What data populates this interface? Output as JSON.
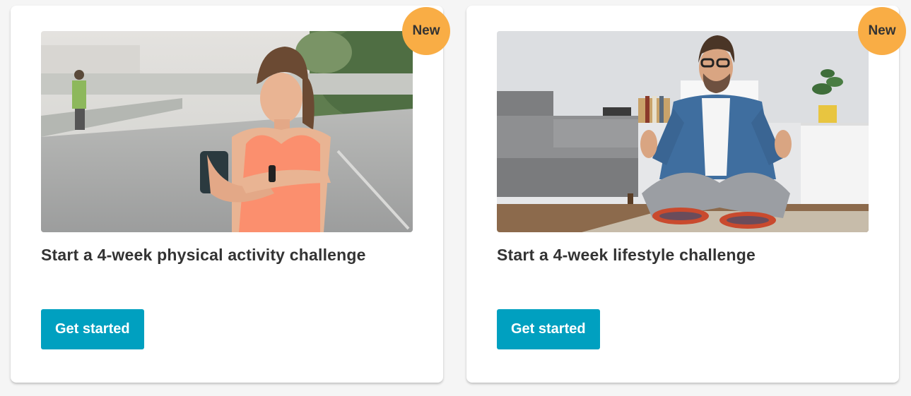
{
  "cards": [
    {
      "badge": "New",
      "title": "Start a 4-week physical activity challenge",
      "button_label": "Get started",
      "image": "woman-runner-checking-fitness-tracker"
    },
    {
      "badge": "New",
      "title": "Start a 4-week lifestyle challenge",
      "button_label": "Get started",
      "image": "man-meditating-in-living-room"
    }
  ],
  "colors": {
    "badge": "#f9ad45",
    "button": "#00a0c0",
    "title_text": "#333333",
    "page_bg": "#f5f5f5",
    "card_bg": "#ffffff"
  }
}
